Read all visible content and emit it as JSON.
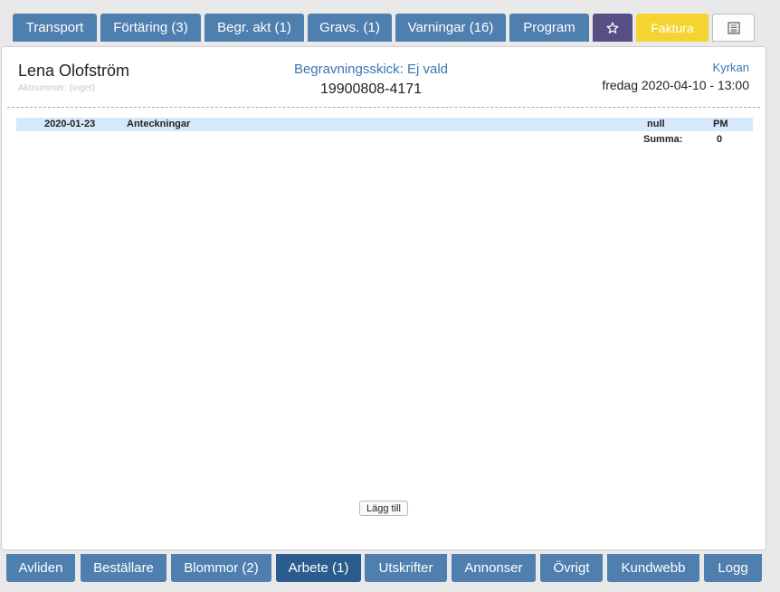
{
  "top_tabs": {
    "transport": "Transport",
    "fortaring": "Förtäring (3)",
    "begr_akt": "Begr. akt (1)",
    "gravs": "Gravs. (1)",
    "varningar": "Varningar (16)",
    "program": "Program",
    "star_icon": "star-icon",
    "faktura": "Faktura",
    "list_icon": "list-icon"
  },
  "header": {
    "name": "Lena Olofström",
    "aktnummer": "Aktnummer: (inget)",
    "begravningsskick": "Begravningsskick: Ej vald",
    "personnummer": "19900808-4171",
    "location": "Kyrkan",
    "datetime": "fredag 2020-04-10 - 13:00"
  },
  "work_rows": [
    {
      "date": "2020-01-23",
      "title": "Anteckningar",
      "value": "null",
      "initials": "PM"
    }
  ],
  "summary": {
    "label": "Summa:",
    "value": "0"
  },
  "add_button": "Lägg till",
  "bottom_tabs": {
    "avliden": "Avliden",
    "bestallare": "Beställare",
    "blommor": "Blommor (2)",
    "arbete": "Arbete (1)",
    "utskrifter": "Utskrifter",
    "annonser": "Annonser",
    "ovrigt": "Övrigt",
    "kundwebb": "Kundwebb",
    "logg": "Logg"
  },
  "colors": {
    "tab": "#4f7fae",
    "tab_active": "#2a5c8e",
    "star_tab": "#554f83",
    "faktura_tab": "#f5d431",
    "link": "#3776b3",
    "row_highlight": "#d6e9fb"
  }
}
